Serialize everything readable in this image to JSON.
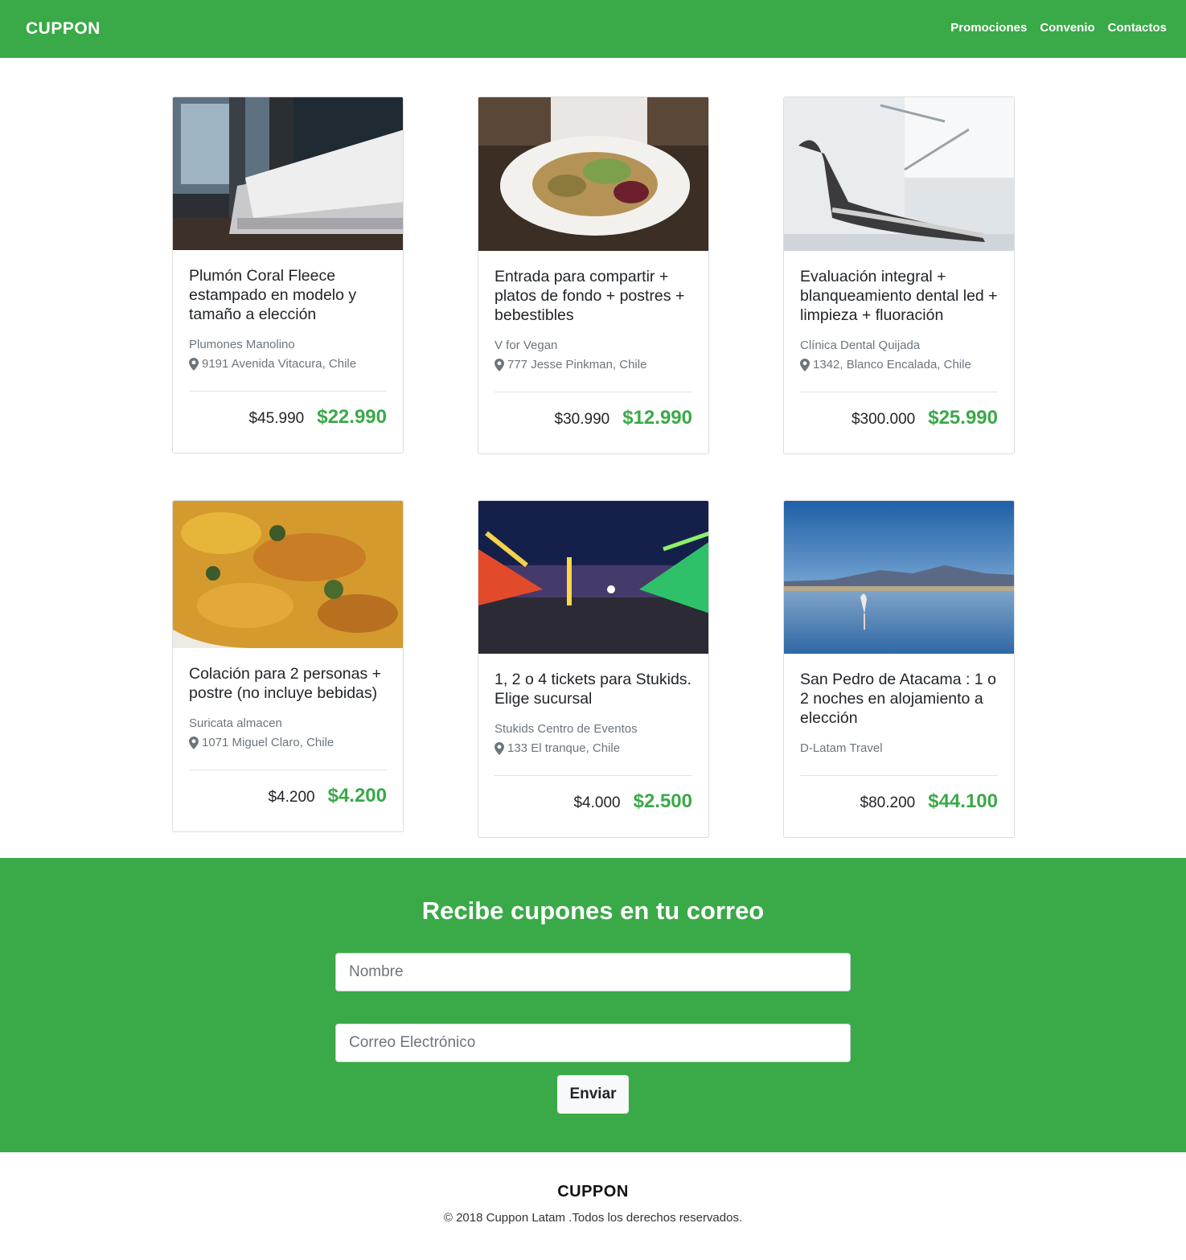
{
  "nav": {
    "brand": "CUPPON",
    "links": [
      "Promociones",
      "Convenio",
      "Contactos"
    ]
  },
  "deals": [
    {
      "image": "bedroom-photo",
      "title": "Plumón Coral Fleece estampado en modelo y tamaño a elección",
      "vendor": "Plumones Manolino",
      "address": "9191 Avenida Vitacura, Chile",
      "old_price": "$45.990",
      "new_price": "$22.990"
    },
    {
      "image": "vegan-salad-photo",
      "title": "Entrada para compartir + platos de fondo + postres + bebestibles",
      "vendor": "V for Vegan",
      "address": "777 Jesse Pinkman, Chile",
      "old_price": "$30.990",
      "new_price": "$12.990"
    },
    {
      "image": "dental-chair-photo",
      "title": "Evaluación integral + blanqueamiento dental led + limpieza + fluoración",
      "vendor": "Clínica Dental Quijada",
      "address": "1342, Blanco Encalada, Chile",
      "old_price": "$300.000",
      "new_price": "$25.990"
    },
    {
      "image": "food-dish-photo",
      "title": "Colación para 2 personas + postre (no incluye bebidas)",
      "vendor": "Suricata almacen",
      "address": "1071 Miguel Claro, Chile",
      "old_price": "$4.200",
      "new_price": "$4.200"
    },
    {
      "image": "fairground-night-photo",
      "title": "1, 2 o 4 tickets para Stukids. Elige sucursal",
      "vendor": "Stukids Centro de Eventos",
      "address": "133 El tranque, Chile",
      "old_price": "$4.000",
      "new_price": "$2.500"
    },
    {
      "image": "flamingo-lake-photo",
      "title": "San Pedro de Atacama : 1 o 2 noches en alojamiento a elección",
      "vendor": "D-Latam Travel",
      "address": "",
      "old_price": "$80.200",
      "new_price": "$44.100"
    }
  ],
  "subscribe": {
    "title": "Recibe cupones en tu correo",
    "name_placeholder": "Nombre",
    "name_value": "",
    "email_placeholder": "Correo Electrónico",
    "email_value": "",
    "submit_label": "Enviar"
  },
  "footer": {
    "brand": "CUPPON",
    "copyright": "© 2018 Cuppon Latam .Todos los derechos reservados."
  },
  "colors": {
    "brand_green": "#3aa948"
  }
}
